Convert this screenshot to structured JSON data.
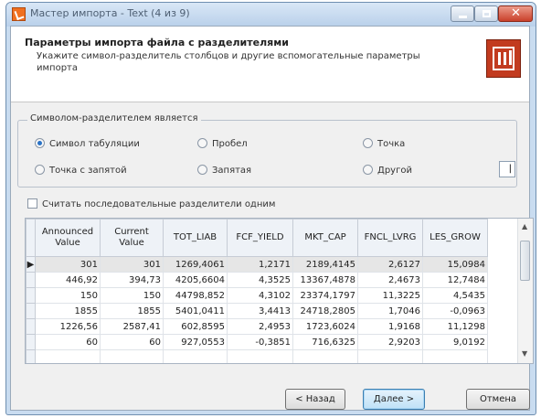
{
  "window": {
    "title": "Мастер импорта - Text (4 из 9)",
    "controls": {
      "minimize": "minimize-icon",
      "maximize": "maximize-icon",
      "close": "close-icon"
    }
  },
  "header": {
    "title": "Параметры импорта файла с разделителями",
    "description": "Укажите символ-разделитель столбцов и другие вспомогательные параметры импорта"
  },
  "delimiters": {
    "legend": "Символом-разделителем является",
    "options": [
      {
        "label": "Символ табуляции",
        "selected": true
      },
      {
        "label": "Пробел",
        "selected": false
      },
      {
        "label": "Точка",
        "selected": false
      },
      {
        "label": "Точка с запятой",
        "selected": false
      },
      {
        "label": "Запятая",
        "selected": false
      },
      {
        "label": "Другой",
        "selected": false
      }
    ],
    "other_value": "|"
  },
  "treat_consecutive": {
    "label": "Считать последовательные разделители одним",
    "checked": false
  },
  "preview": {
    "columns": [
      {
        "line1": "Announced",
        "line2": "Value"
      },
      {
        "line1": "Current",
        "line2": "Value"
      },
      {
        "line1": "TOT_LIAB",
        "line2": ""
      },
      {
        "line1": "FCF_YIELD",
        "line2": ""
      },
      {
        "line1": "MKT_CAP",
        "line2": ""
      },
      {
        "line1": "FNCL_LVRG",
        "line2": ""
      },
      {
        "line1": "LES_GROW",
        "line2": ""
      }
    ],
    "current_row_marker": "▶",
    "rows": [
      [
        "301",
        "301",
        "1269,4061",
        "1,2171",
        "2189,4145",
        "2,6127",
        "15,0984"
      ],
      [
        "446,92",
        "394,73",
        "4205,6604",
        "4,3525",
        "13367,4878",
        "2,4673",
        "12,7484"
      ],
      [
        "150",
        "150",
        "44798,852",
        "4,3102",
        "23374,1797",
        "11,3225",
        "4,5435"
      ],
      [
        "1855",
        "1855",
        "5401,0411",
        "3,4413",
        "24718,2805",
        "1,7046",
        "-0,0963"
      ],
      [
        "1226,56",
        "2587,41",
        "602,8595",
        "2,4953",
        "1723,6024",
        "1,9168",
        "11,1298"
      ],
      [
        "60",
        "60",
        "927,0553",
        "-0,3851",
        "716,6325",
        "2,9203",
        "9,0192"
      ],
      [
        "",
        "",
        "",
        "",
        "",
        "",
        ""
      ]
    ]
  },
  "buttons": {
    "back": "< Назад",
    "next": "Далее >",
    "cancel": "Отмена"
  },
  "colors": {
    "title_bar": "#c9dcf0",
    "close_button": "#c9402a",
    "default_button": "#bfe1f7",
    "logo": "#c23b1f"
  }
}
